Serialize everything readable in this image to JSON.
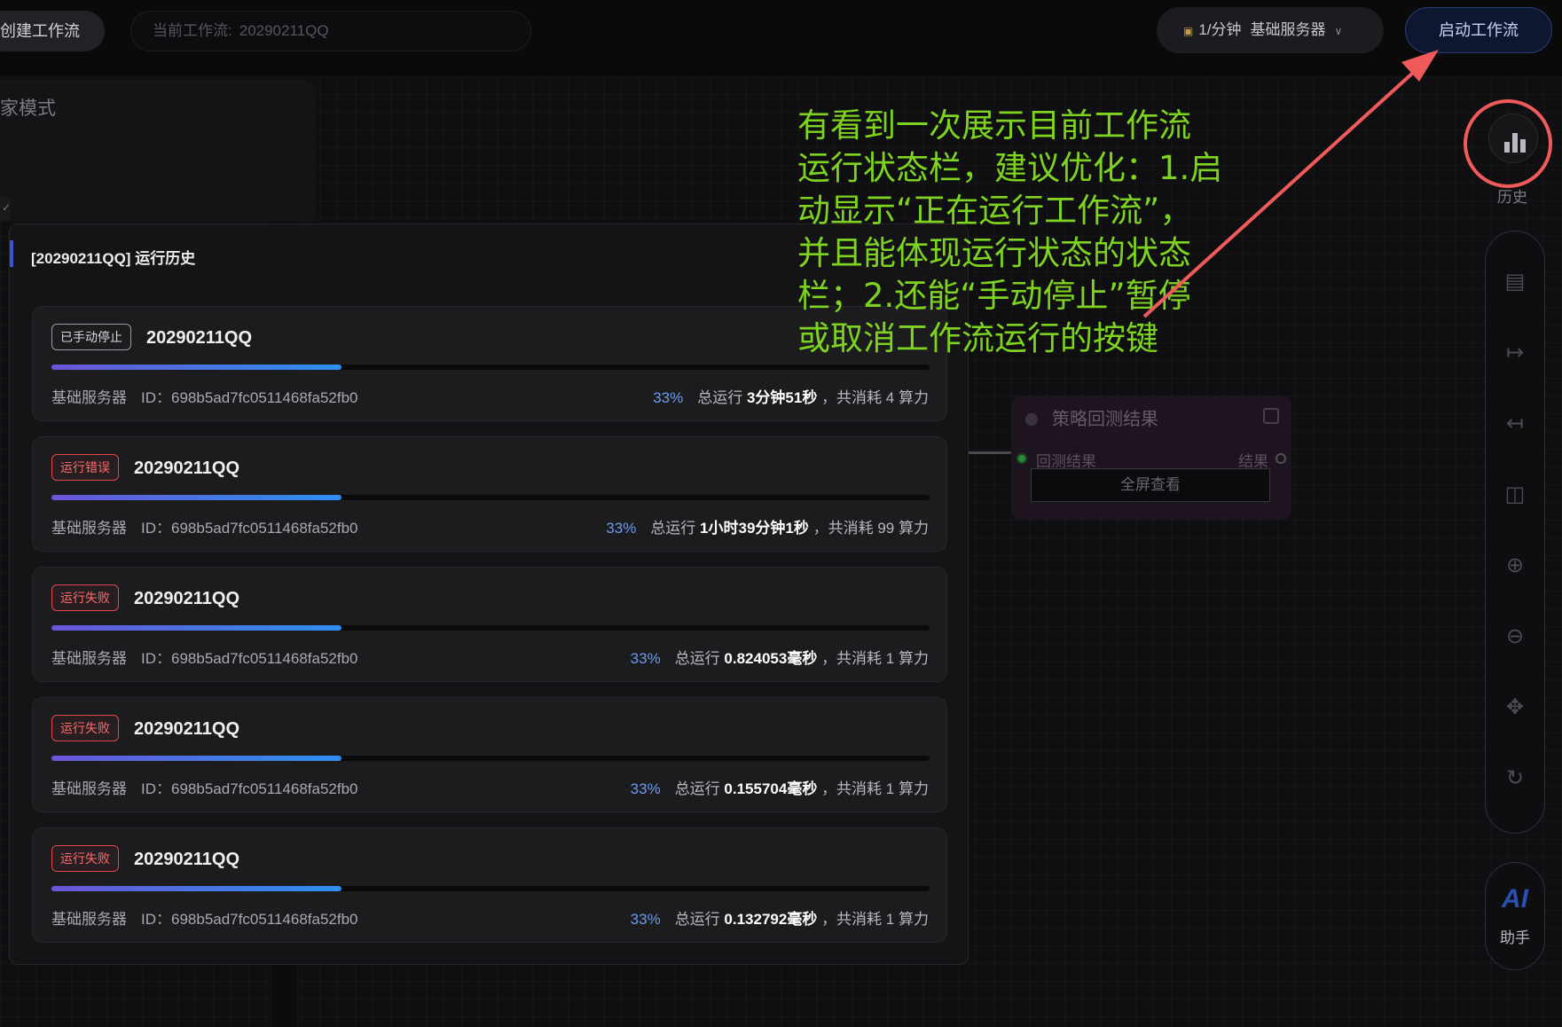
{
  "topbar": {
    "create_label": "创建工作流",
    "current_flow_label": "当前工作流:",
    "current_flow_value": "20290211QQ",
    "rate_label": "1/分钟",
    "server_label": "基础服务器",
    "start_label": "启动工作流"
  },
  "left_panel": {
    "mode_title": "家模式"
  },
  "history": {
    "title": "[20290211QQ] 运行历史",
    "runs": [
      {
        "status": "已手动停止",
        "status_type": "stop",
        "name": "20290211QQ",
        "progress": 0.33,
        "server": "基础服务器",
        "id": "ID：698b5ad7fc0511468fa52fb0",
        "pct": "33%",
        "total_prefix": "总运行",
        "duration": "3分钟51秒",
        "cost_prefix": "，共消耗",
        "cost": "4",
        "cost_unit": "算力"
      },
      {
        "status": "运行错误",
        "status_type": "err",
        "name": "20290211QQ",
        "progress": 0.33,
        "server": "基础服务器",
        "id": "ID：698b5ad7fc0511468fa52fb0",
        "pct": "33%",
        "total_prefix": "总运行",
        "duration": "1小时39分钟1秒",
        "cost_prefix": "，共消耗",
        "cost": "99",
        "cost_unit": "算力"
      },
      {
        "status": "运行失败",
        "status_type": "err",
        "name": "20290211QQ",
        "progress": 0.33,
        "server": "基础服务器",
        "id": "ID：698b5ad7fc0511468fa52fb0",
        "pct": "33%",
        "total_prefix": "总运行",
        "duration": "0.824053毫秒",
        "cost_prefix": "，共消耗",
        "cost": "1",
        "cost_unit": "算力"
      },
      {
        "status": "运行失败",
        "status_type": "err",
        "name": "20290211QQ",
        "progress": 0.33,
        "server": "基础服务器",
        "id": "ID：698b5ad7fc0511468fa52fb0",
        "pct": "33%",
        "total_prefix": "总运行",
        "duration": "0.155704毫秒",
        "cost_prefix": "，共消耗",
        "cost": "1",
        "cost_unit": "算力"
      },
      {
        "status": "运行失败",
        "status_type": "err",
        "name": "20290211QQ",
        "progress": 0.33,
        "server": "基础服务器",
        "id": "ID：698b5ad7fc0511468fa52fb0",
        "pct": "33%",
        "total_prefix": "总运行",
        "duration": "0.132792毫秒",
        "cost_prefix": "，共消耗",
        "cost": "1",
        "cost_unit": "算力"
      }
    ]
  },
  "node": {
    "title": "策略回测结果",
    "input_label": "回测结果",
    "output_label": "结果",
    "fullscreen_label": "全屏查看"
  },
  "toolbar": {
    "history_label": "历史",
    "ai_text": "AI",
    "ai_label": "助手",
    "tools": [
      "save-icon",
      "export-icon",
      "import-icon",
      "delete-icon",
      "zoom-in-icon",
      "zoom-out-icon",
      "move-icon",
      "refresh-icon"
    ]
  },
  "annotation": {
    "text": "有看到一次展示目前工作流运行状态栏，建议优化：1.启动显示“正在运行工作流”，并且能体现运行状态的状态栏；2.还能“手动停止”暂停或取消工作流运行的按键",
    "color": "#7ed321",
    "highlight_color": "#f05a5a"
  }
}
